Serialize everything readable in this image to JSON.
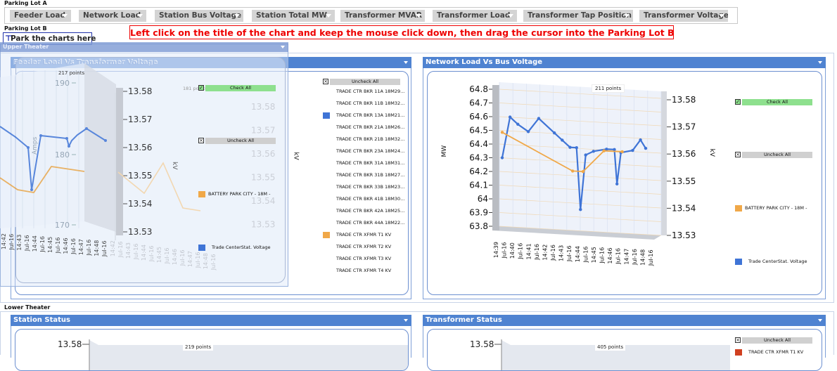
{
  "parking_lot_a": {
    "label": "Parking Lot A",
    "tabs": [
      {
        "label": "Feeder Load"
      },
      {
        "label": "Network Load"
      },
      {
        "label": "Station Bus Voltage"
      },
      {
        "label": "Station Total MW"
      },
      {
        "label": "Transformer MVAR"
      },
      {
        "label": "Transformer Load"
      },
      {
        "label": "Transformer Tap Position"
      },
      {
        "label": "Transformer Voltage"
      }
    ]
  },
  "parking_lot_b": {
    "label": "Parking Lot B",
    "drop_hint": "Park the charts here",
    "pin_icon": "pin-icon"
  },
  "instructions": "Left click on the title of the chart and keep the mouse click down, then drag the cursor into the Parking Lot B",
  "upper_theater": {
    "label": "Upper Theater",
    "feeder_panel": {
      "title": "Feeder Load Vs Transformer Voltage",
      "check_all": "Check All",
      "uncheck_all": "Uncheck All",
      "legend": [
        {
          "label": "TRADE CTR BKR 11A 18M29...",
          "color": ""
        },
        {
          "label": "TRADE CTR BKR 11B 18M32...",
          "color": ""
        },
        {
          "label": "TRADE CTR BKR 13A 18M21...",
          "color": "#3f74d6"
        },
        {
          "label": "TRADE CTR BKR 21A 18M26...",
          "color": ""
        },
        {
          "label": "TRADE CTR BKR 21B 18M32...",
          "color": ""
        },
        {
          "label": "TRADE CTR BKR 23A 18M24...",
          "color": ""
        },
        {
          "label": "TRADE CTR BKR 31A 18M31...",
          "color": ""
        },
        {
          "label": "TRADE CTR BKR 31B 18M27...",
          "color": ""
        },
        {
          "label": "TRADE CTR BKR 33B 18M23...",
          "color": ""
        },
        {
          "label": "TRADE CTR BKR 41B 18M30...",
          "color": ""
        },
        {
          "label": "TRADE CTR BKR 42A 18M25...",
          "color": ""
        },
        {
          "label": "TRADE CTR BKR 44A 18M22...",
          "color": ""
        },
        {
          "label": "TRADE CTR XFMR T1 KV",
          "color": "#f0a848"
        },
        {
          "label": "TRADE CTR XFMR T2 KV",
          "color": ""
        },
        {
          "label": "TRADE CTR XFMR T3 KV",
          "color": ""
        },
        {
          "label": "TRADE CTR XFMR T4 KV",
          "color": ""
        }
      ],
      "right_axis": {
        "unit": "kV",
        "ticks": [
          "13.58",
          "13.57",
          "13.56",
          "13.55",
          "13.54",
          "13.53"
        ]
      }
    },
    "network_panel": {
      "title": "Network Load Vs Bus Voltage",
      "points_label": "211 points",
      "check_all": "Check All",
      "uncheck_all": "Uncheck All",
      "legend": [
        {
          "label": "BATTERY PARK CITY - 18M -",
          "color": "#f0a848"
        },
        {
          "label": "Trade CenterStat. Voltage",
          "color": "#3f74d6"
        }
      ],
      "chart_data": {
        "type": "line",
        "title": "",
        "ylabel": "MW",
        "y2label": "kV",
        "ylim": [
          63.8,
          64.8
        ],
        "y2lim": [
          13.53,
          13.58
        ],
        "y_ticks": [
          "64.8",
          "64.7",
          "64.6",
          "64.5",
          "64.4",
          "64.3",
          "64.2",
          "64.1",
          "64",
          "63.9",
          "63.8"
        ],
        "y2_ticks": [
          "13.58",
          "13.57",
          "13.56",
          "13.55",
          "13.54",
          "13.53"
        ],
        "x_ticks": [
          "14:39",
          "Jul-16",
          "14:40",
          "Jul-16",
          "14:41",
          "Jul-16",
          "14:42",
          "Jul-16",
          "14:43",
          "Jul-16",
          "14:44",
          "Jul-16",
          "14:45",
          "Jul-16",
          "14:46",
          "Jul-16",
          "14:47",
          "Jul-16",
          "14:48",
          "Jul-16"
        ],
        "series": [
          {
            "name": "Trade CenterStat. Voltage",
            "axis": "left",
            "color": "#3f74d6",
            "x": [
              0,
              0.3,
              0.6,
              1.0,
              1.4,
              2.0,
              2.3,
              2.6,
              2.85,
              3.0,
              3.2,
              3.5,
              4.0,
              4.3,
              4.4,
              4.55,
              5.0,
              5.3,
              5.5
            ],
            "values": [
              64.3,
              64.6,
              64.55,
              64.5,
              64.6,
              64.5,
              64.45,
              64.4,
              64.4,
              63.95,
              64.35,
              64.38,
              64.4,
              64.4,
              64.15,
              64.38,
              64.4,
              64.48,
              64.42
            ]
          },
          {
            "name": "BATTERY PARK CITY - 18M -",
            "axis": "right",
            "color": "#f0a848",
            "x": [
              0,
              2.7,
              3.1,
              3.9,
              4.6
            ],
            "values": [
              13.568,
              13.555,
              13.555,
              13.563,
              13.563
            ]
          }
        ]
      }
    }
  },
  "floating_chart": {
    "title": "Feeder Load Vs Transformer Voltage",
    "points_label": "217 points",
    "points_label_2": "181 points",
    "check_all": "Check All",
    "uncheck_all": "Uncheck All",
    "legend": [
      {
        "label": "BATTERY PARK CITY - 18M -",
        "color": "#f0a848"
      },
      {
        "label": "Trade CenterStat. Voltage",
        "color": "#3f74d6"
      }
    ],
    "chart_data": {
      "type": "line",
      "title": "",
      "ylabel": "Amps",
      "y2label": "kV",
      "y_ticks": [
        "190",
        "180",
        "170"
      ],
      "y2_ticks": [
        "13.58",
        "13.57",
        "13.56",
        "13.55",
        "13.54",
        "13.53"
      ],
      "x_ticks": [
        "14:42",
        "Jul-16",
        "14:43",
        "Jul-16",
        "14:44",
        "Jul-16",
        "14:45",
        "Jul-16",
        "14:46",
        "Jul-16",
        "14:47",
        "Jul-16",
        "14:48",
        "Jul-16"
      ]
    }
  },
  "lower_theater": {
    "label": "Lower Theater",
    "station_panel": {
      "title": "Station Status",
      "points_label": "219 points",
      "top_tick": "13.58"
    },
    "transformer_panel": {
      "title": "Transformer Status",
      "points_label": "405 points",
      "top_tick": "13.58",
      "uncheck_all": "Uncheck All",
      "legend": [
        {
          "label": "TRADE CTR XFMR T1 KV",
          "color": "#d04020"
        }
      ]
    }
  },
  "colors": {
    "accent": "#4f83d1",
    "series_blue": "#3f74d6",
    "series_orange": "#f0a848",
    "check_green": "#8ee08e",
    "warning_red": "#ee0000"
  }
}
